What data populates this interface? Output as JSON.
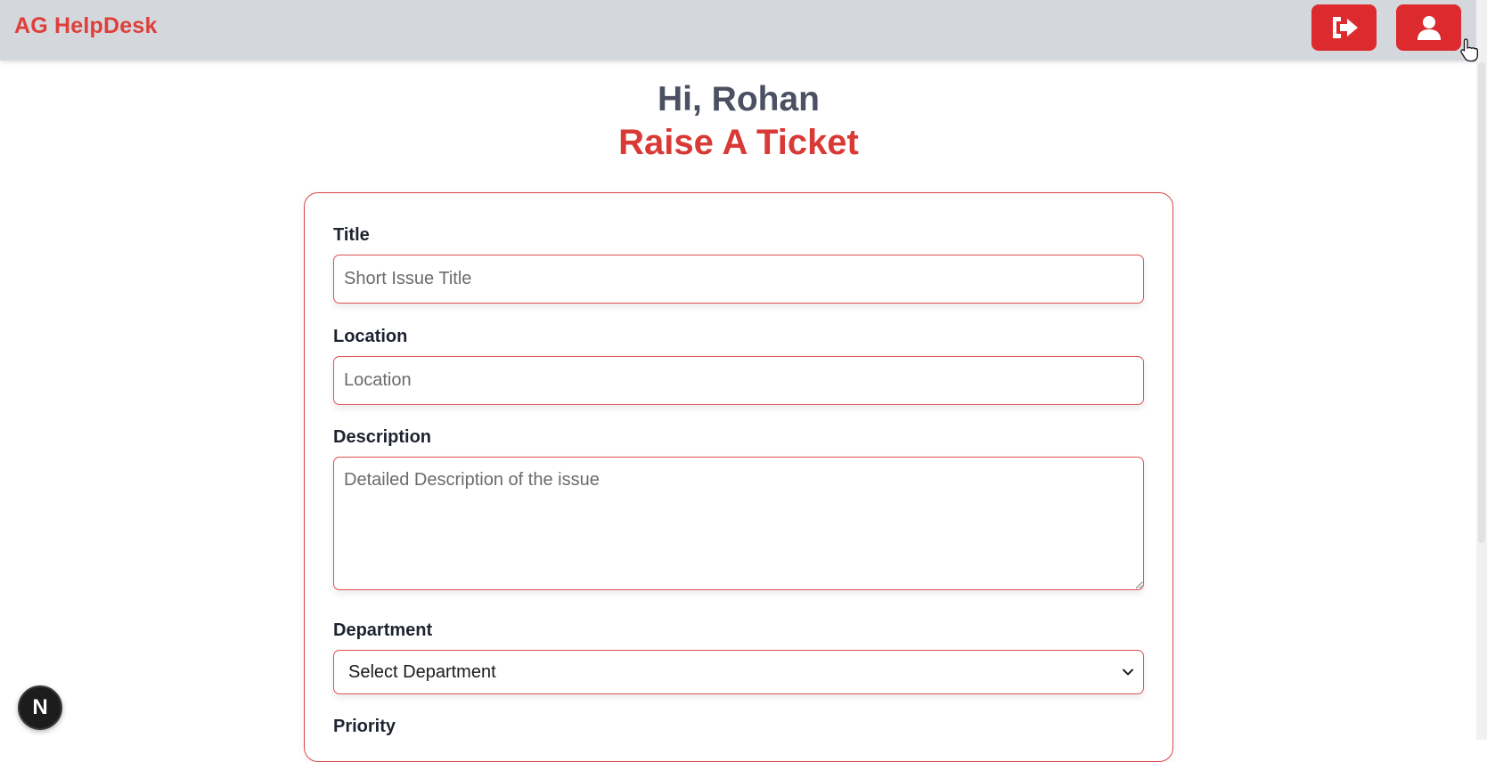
{
  "navbar": {
    "brand": "AG HelpDesk",
    "logout_icon": "sign-out-icon",
    "profile_icon": "user-icon",
    "accent_color": "#dc2a2f"
  },
  "header": {
    "greeting": "Hi, Rohan",
    "title": "Raise A Ticket"
  },
  "form": {
    "title": {
      "label": "Title",
      "placeholder": "Short Issue Title",
      "value": ""
    },
    "location": {
      "label": "Location",
      "placeholder": "Location",
      "value": ""
    },
    "description": {
      "label": "Description",
      "placeholder": "Detailed Description of the issue",
      "value": ""
    },
    "department": {
      "label": "Department",
      "selected": "Select Department"
    },
    "priority": {
      "label": "Priority"
    }
  },
  "dev_badge": {
    "letter": "N",
    "icon": "nextjs-icon"
  }
}
